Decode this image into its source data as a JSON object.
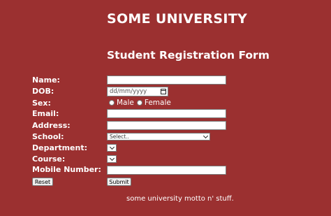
{
  "header": {
    "university": "SOME UNIVERSITY",
    "form_title": "Student Registration Form"
  },
  "labels": {
    "name": "Name:",
    "dob": "DOB:",
    "sex": "Sex:",
    "email": "Email:",
    "address": "Address:",
    "school": "School:",
    "department": "Department:",
    "course": "Course:",
    "mobile": "Mobile Number:"
  },
  "fields": {
    "dob_placeholder": "dd/mm/yyyy",
    "school_selected": "Select..",
    "sex_options": [
      "Male",
      "Female"
    ]
  },
  "buttons": {
    "reset": "Reset",
    "submit": "Submit"
  },
  "footer": {
    "motto": "some university motto n' stuff."
  }
}
